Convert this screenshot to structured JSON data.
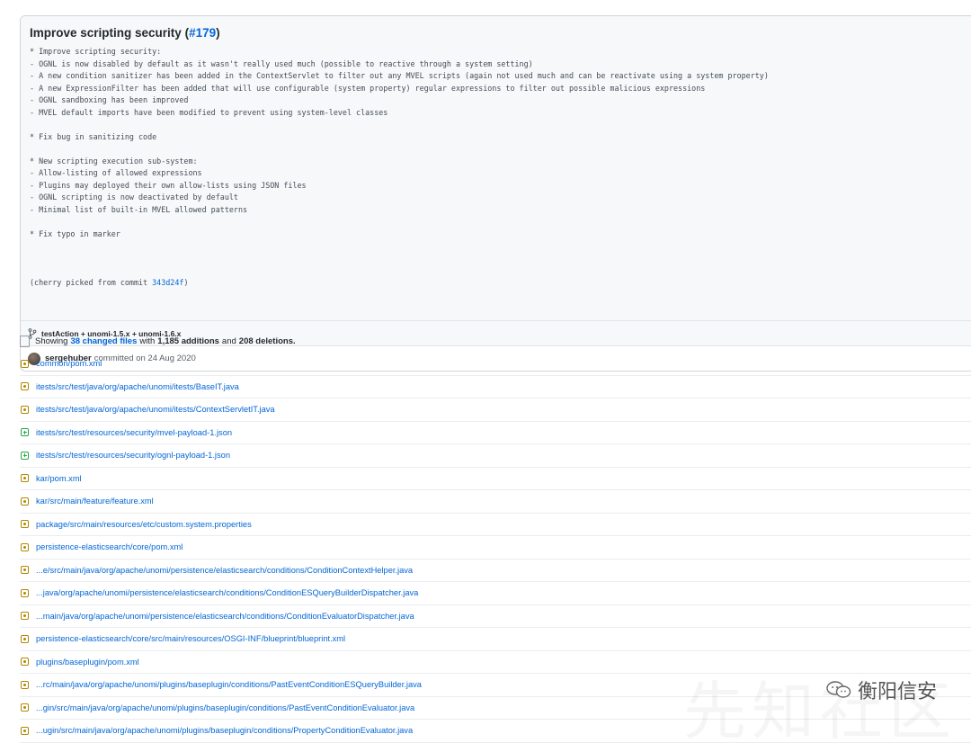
{
  "commit": {
    "title": "Improve scripting security",
    "pr_link": "#179",
    "description_lines": [
      "* Improve scripting security:",
      "- OGNL is now disabled by default as it wasn't really used much (possible to reactive through a system setting)",
      "- A new condition sanitizer has been added in the ContextServlet to filter out any MVEL scripts (again not used much and can be reactivate using a system property)",
      "- A new ExpressionFilter has been added that will use configurable (system property) regular expressions to filter out possible malicious expressions",
      "- OGNL sandboxing has been improved",
      "- MVEL default imports have been modified to prevent using system-level classes",
      "",
      "* Fix bug in sanitizing code",
      "",
      "* New scripting execution sub-system:",
      "- Allow-listing of allowed expressions",
      "- Plugins may deployed their own allow-lists using JSON files",
      "- OGNL scripting is now deactivated by default",
      "- Minimal list of built-in MVEL allowed patterns",
      "",
      "* Fix typo in marker",
      ""
    ],
    "cherry_pick_prefix": "(cherry picked from commit ",
    "cherry_pick_hash": "343d24f",
    "cherry_pick_suffix": ")",
    "branches": "testAction + unomi-1.5.x + unomi-1.6.x",
    "author": "sergehuber",
    "committed_text": "committed on 24 Aug 2020"
  },
  "summary": {
    "showing": "Showing",
    "changed_files": "38 changed files",
    "with": "with",
    "additions": "1,185 additions",
    "and": "and",
    "deletions": "208 deletions."
  },
  "files": [
    {
      "path": "common/pom.xml",
      "status": "modified"
    },
    {
      "path": "itests/src/test/java/org/apache/unomi/itests/BaseIT.java",
      "status": "modified"
    },
    {
      "path": "itests/src/test/java/org/apache/unomi/itests/ContextServletIT.java",
      "status": "modified"
    },
    {
      "path": "itests/src/test/resources/security/mvel-payload-1.json",
      "status": "added"
    },
    {
      "path": "itests/src/test/resources/security/ognl-payload-1.json",
      "status": "added"
    },
    {
      "path": "kar/pom.xml",
      "status": "modified"
    },
    {
      "path": "kar/src/main/feature/feature.xml",
      "status": "modified"
    },
    {
      "path": "package/src/main/resources/etc/custom.system.properties",
      "status": "modified"
    },
    {
      "path": "persistence-elasticsearch/core/pom.xml",
      "status": "modified"
    },
    {
      "path": "...e/src/main/java/org/apache/unomi/persistence/elasticsearch/conditions/ConditionContextHelper.java",
      "status": "modified"
    },
    {
      "path": "...java/org/apache/unomi/persistence/elasticsearch/conditions/ConditionESQueryBuilderDispatcher.java",
      "status": "modified"
    },
    {
      "path": "...main/java/org/apache/unomi/persistence/elasticsearch/conditions/ConditionEvaluatorDispatcher.java",
      "status": "modified"
    },
    {
      "path": "persistence-elasticsearch/core/src/main/resources/OSGI-INF/blueprint/blueprint.xml",
      "status": "modified"
    },
    {
      "path": "plugins/baseplugin/pom.xml",
      "status": "modified"
    },
    {
      "path": "...rc/main/java/org/apache/unomi/plugins/baseplugin/conditions/PastEventConditionESQueryBuilder.java",
      "status": "modified"
    },
    {
      "path": "...gin/src/main/java/org/apache/unomi/plugins/baseplugin/conditions/PastEventConditionEvaluator.java",
      "status": "modified"
    },
    {
      "path": "...ugin/src/main/java/org/apache/unomi/plugins/baseplugin/conditions/PropertyConditionEvaluator.java",
      "status": "modified"
    }
  ],
  "watermark": {
    "text": "衡阳信安",
    "background_text": "先知社区"
  }
}
